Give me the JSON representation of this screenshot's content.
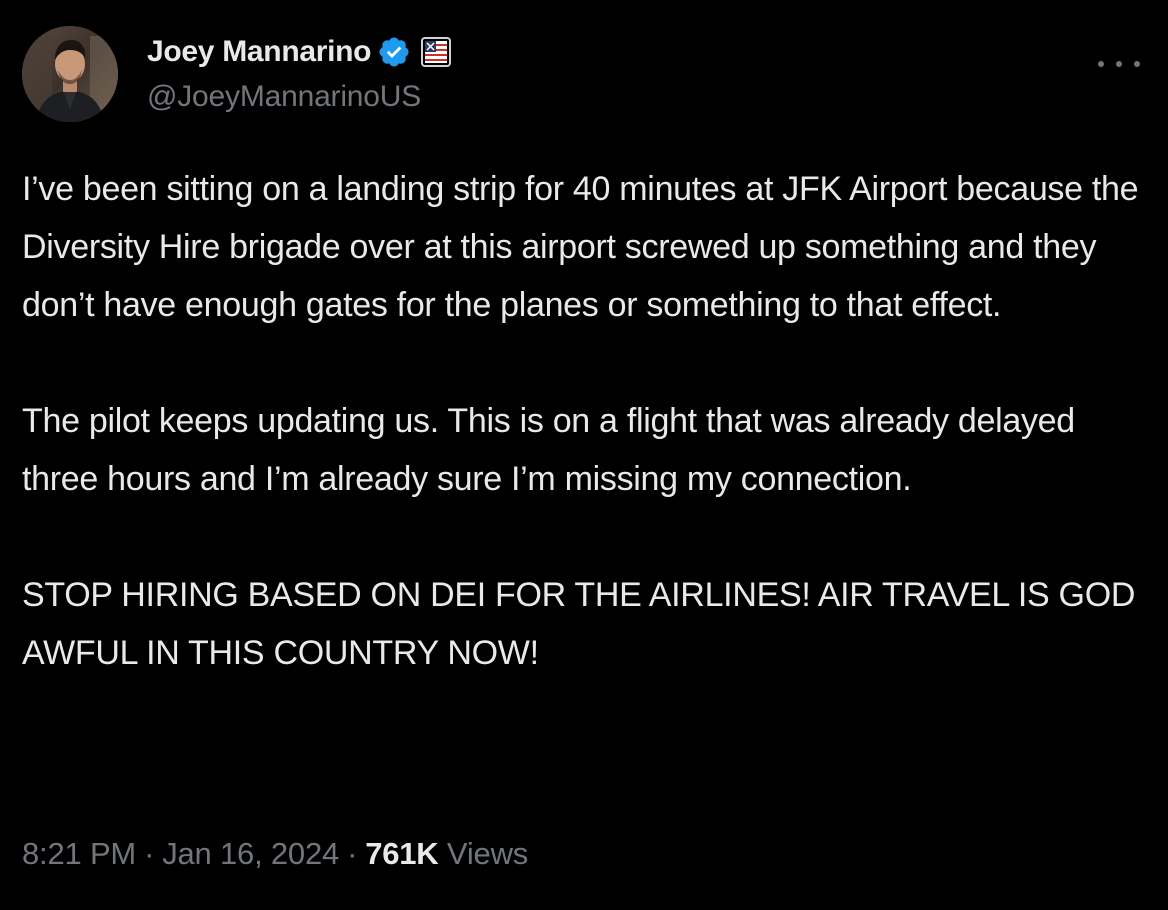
{
  "author": {
    "display_name": "Joey Mannarino",
    "handle": "@JoeyMannarinoUS",
    "verified": true,
    "avatar_icon": "user-avatar-photo",
    "badge_icon": "affiliate-flag-badge"
  },
  "tweet": {
    "paragraphs": [
      "I’ve been sitting on a landing strip for 40 minutes at JFK Airport because the Diversity Hire brigade over at this airport screwed up something and they don’t have enough gates for the planes or something to that effect.",
      "The pilot keeps updating us. This is on a flight that was already delayed three hours and I’m already sure I’m missing my connection.",
      "STOP HIRING BASED ON DEI FOR THE AIRLINES! AIR TRAVEL IS GOD AWFUL IN THIS COUNTRY NOW!"
    ],
    "time": "8:21 PM",
    "separator": "·",
    "date": "Jan 16, 2024",
    "views_count": "761K",
    "views_label": "Views"
  },
  "icons": {
    "more": "more-dots-icon",
    "verified": "verified-check-icon"
  },
  "colors": {
    "background": "#000000",
    "text_primary": "#e7e9ea",
    "text_secondary": "#71767b",
    "verified_blue": "#1d9bf0"
  }
}
